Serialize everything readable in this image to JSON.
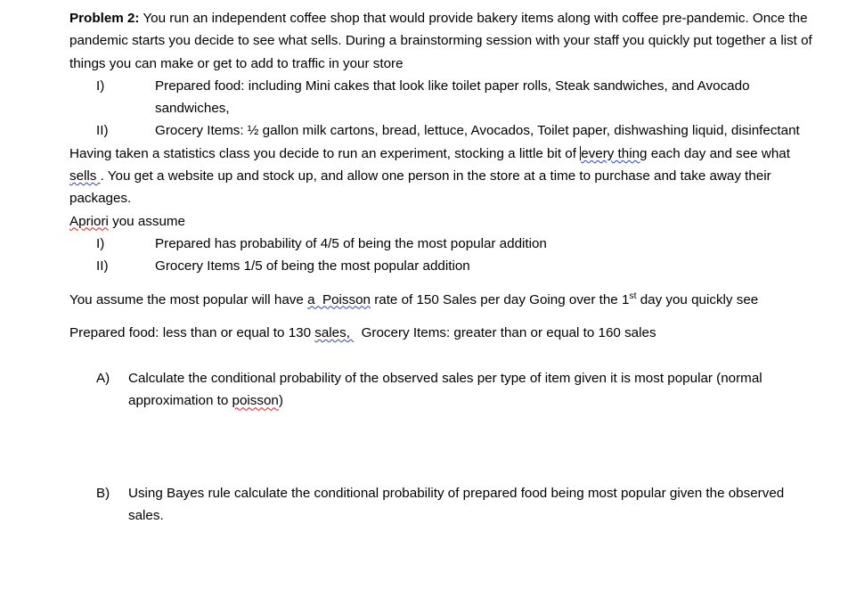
{
  "document": {
    "intro": {
      "label": "Problem 2:",
      "body": " You run an independent coffee shop that would provide bakery items along with coffee pre-pandemic. Once the pandemic starts you decide to see what sells. During a brainstorming session with your staff you quickly put together a list of things you can make or get to add to traffic in your store"
    },
    "items_list": [
      {
        "marker": "I)",
        "text": "Prepared food:  including Mini cakes that look like toilet paper rolls, Steak sandwiches, and Avocado sandwiches,"
      },
      {
        "marker": "II)",
        "text": "Grocery Items: ½ gallon milk cartons, bread, lettuce, Avocados, Toilet paper, dishwashing liquid, disinfectant"
      }
    ],
    "experiment_para": {
      "part1": "Having taken a statistics class you decide to run an experiment, stocking a little bit of ",
      "flagged1": "every thing",
      "part2": " each day and see what ",
      "flagged2": "sells ",
      "part3": ". You get a website up and stock up, and allow one person in the store at a time to purchase and take away their packages."
    },
    "apriori_line": {
      "flagged": "Apriori",
      "rest": " you assume"
    },
    "apriori_list": [
      {
        "marker": "I)",
        "text": "Prepared has probability of 4/5 of being the most popular addition"
      },
      {
        "marker": "II)",
        "text": "Grocery Items 1/5 of being the most popular addition"
      }
    ],
    "poisson_para": {
      "part1": "You assume the most popular will have ",
      "flagged": "a  Poisson",
      "part2": " rate of 150 Sales per day Going over the 1",
      "ordinal": "st",
      "part3": " day you quickly see"
    },
    "observed_para": {
      "part1": "Prepared food: less than or equal to 130 ",
      "flagged": "sales, ",
      "part2": "  Grocery Items: greater than or equal to 160 sales"
    },
    "questions": [
      {
        "marker": "A)",
        "part1": "Calculate the conditional probability of the observed sales per type of item given it is most popular (normal approximation to ",
        "flagged": "poisson",
        "part2": ")"
      },
      {
        "marker": "B)",
        "part1": "Using Bayes rule calculate the conditional probability of prepared food being most popular given the observed sales.",
        "flagged": "",
        "part2": ""
      }
    ]
  },
  "colors": {
    "text": "#000000",
    "spelling_underline": "#e01b1b",
    "grammar_underline": "#2b40c8",
    "page_background": "#ffffff"
  }
}
